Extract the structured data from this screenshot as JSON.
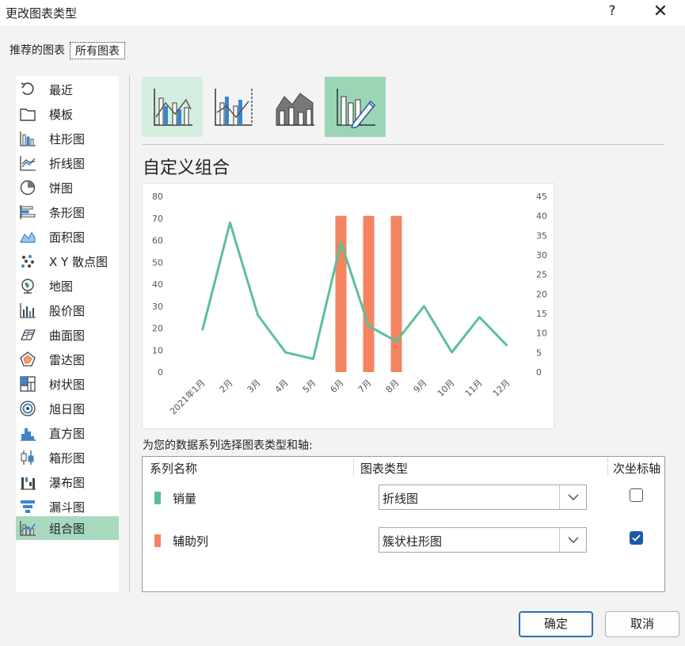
{
  "dialog": {
    "title": "更改图表类型",
    "help_glyph": "?",
    "close_glyph": "✕"
  },
  "tabs": [
    {
      "label": "推荐的图表",
      "active": false
    },
    {
      "label": "所有图表",
      "active": true
    }
  ],
  "nav": {
    "items": [
      {
        "label": "最近",
        "icon": "recent-icon"
      },
      {
        "label": "模板",
        "icon": "folder-icon"
      },
      {
        "label": "柱形图",
        "icon": "column-chart-icon"
      },
      {
        "label": "折线图",
        "icon": "line-chart-icon"
      },
      {
        "label": "饼图",
        "icon": "pie-chart-icon"
      },
      {
        "label": "条形图",
        "icon": "bar-chart-icon"
      },
      {
        "label": "面积图",
        "icon": "area-chart-icon"
      },
      {
        "label": "X Y 散点图",
        "icon": "scatter-chart-icon"
      },
      {
        "label": "地图",
        "icon": "map-chart-icon"
      },
      {
        "label": "股价图",
        "icon": "stock-chart-icon"
      },
      {
        "label": "曲面图",
        "icon": "surface-chart-icon"
      },
      {
        "label": "雷达图",
        "icon": "radar-chart-icon"
      },
      {
        "label": "树状图",
        "icon": "treemap-chart-icon"
      },
      {
        "label": "旭日图",
        "icon": "sunburst-chart-icon"
      },
      {
        "label": "直方图",
        "icon": "histogram-chart-icon"
      },
      {
        "label": "箱形图",
        "icon": "box-whisker-chart-icon"
      },
      {
        "label": "瀑布图",
        "icon": "waterfall-chart-icon"
      },
      {
        "label": "漏斗图",
        "icon": "funnel-chart-icon"
      },
      {
        "label": "组合图",
        "icon": "combo-chart-icon"
      }
    ],
    "selected_index": 18
  },
  "combo": {
    "subtypes": [
      "clustered-column-line-icon",
      "clustered-column-line-secondary-icon",
      "stacked-area-column-icon",
      "custom-combination-icon"
    ],
    "selected_subtype": 3,
    "title": "自定义组合"
  },
  "chart_data": {
    "type": "line",
    "title": "",
    "categories": [
      "2021年1月",
      "2月",
      "3月",
      "4月",
      "5月",
      "6月",
      "7月",
      "8月",
      "9月",
      "10月",
      "11月",
      "12月"
    ],
    "series": [
      {
        "name": "销量",
        "type": "line",
        "axis": "primary",
        "color": "#5cbf9b",
        "values": [
          19,
          68,
          26,
          9,
          6,
          59,
          21,
          14,
          30,
          9,
          25,
          12
        ]
      },
      {
        "name": "辅助列",
        "type": "bar",
        "axis": "secondary",
        "color": "#f4845f",
        "values": [
          0,
          0,
          0,
          0,
          0,
          40,
          40,
          40,
          0,
          0,
          0,
          0
        ]
      }
    ],
    "y_primary": {
      "min": 0,
      "max": 80,
      "ticks": [
        "0",
        "10",
        "20",
        "30",
        "40",
        "50",
        "60",
        "70",
        "80"
      ]
    },
    "y_secondary": {
      "min": 0,
      "max": 45,
      "ticks": [
        "0",
        "5",
        "10",
        "15",
        "20",
        "25",
        "30",
        "35",
        "40",
        "45"
      ]
    },
    "grid": false,
    "legend": "none"
  },
  "assign": {
    "label": "为您的数据系列选择图表类型和轴:",
    "headers": {
      "name": "系列名称",
      "type": "图表类型",
      "secondary": "次坐标轴"
    },
    "rows": [
      {
        "name": "销量",
        "color": "#5cbf9b",
        "chart_type": "折线图",
        "secondary_axis": false
      },
      {
        "name": "辅助列",
        "color": "#f4845f",
        "chart_type": "簇状柱形图",
        "secondary_axis": true
      }
    ]
  },
  "buttons": {
    "ok": "确定",
    "cancel": "取消"
  }
}
